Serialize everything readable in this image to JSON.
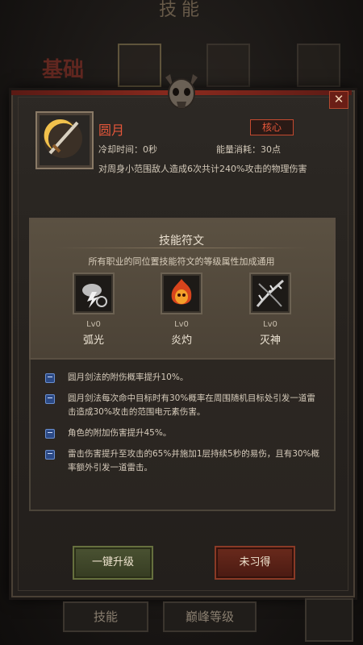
{
  "page": {
    "title": "技能"
  },
  "top_tabs": {
    "basic_label": "基础"
  },
  "skill": {
    "name": "圆月",
    "badge": "核心",
    "cooldown": "冷却时间：0秒",
    "energy": "能量消耗：30点",
    "description": "对周身小范围敌人造成6次共计240%攻击的物理伤害"
  },
  "runes": {
    "title": "技能符文",
    "subtitle": "所有职业的同位置技能符文的等级属性加成通用",
    "items": [
      {
        "level": "Lv0",
        "name": "弧光",
        "icon": "lightning-cloud-icon"
      },
      {
        "level": "Lv0",
        "name": "炎灼",
        "icon": "fire-demon-icon"
      },
      {
        "level": "Lv0",
        "name": "灭神",
        "icon": "thorn-branch-icon"
      }
    ]
  },
  "effects": [
    "圆月剑法的附伤概率提升10%。",
    "圆月剑法每次命中目标时有30%概率在周围随机目标处引发一道雷击造成30%攻击的范围电元素伤害。",
    "角色的附加伤害提升45%。",
    "雷击伤害提升至攻击的65%并施加1层持续5秒的易伤，且有30%概率额外引发一道雷击。"
  ],
  "buttons": {
    "upgrade": "一键升级",
    "status": "未习得"
  },
  "bottom_tabs": {
    "skills": "技能",
    "peak_level": "巅峰等级"
  },
  "colors": {
    "accent_red": "#e4563a",
    "gold_frame": "#8a7a66"
  }
}
